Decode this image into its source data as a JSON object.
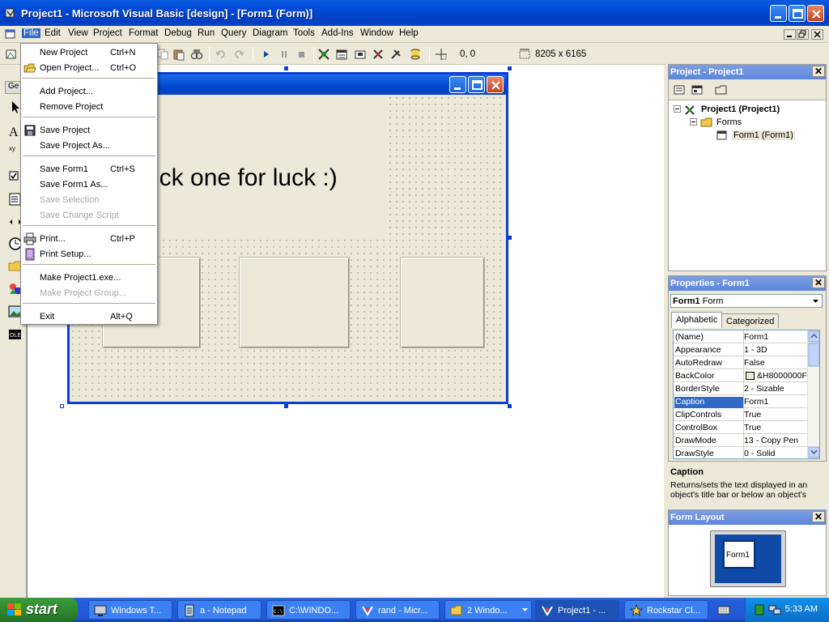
{
  "window": {
    "title": "Project1 - Microsoft Visual Basic [design] - [Form1 (Form)]"
  },
  "menubar": {
    "items": [
      "File",
      "Edit",
      "View",
      "Project",
      "Format",
      "Debug",
      "Run",
      "Query",
      "Diagram",
      "Tools",
      "Add-Ins",
      "Window",
      "Help"
    ],
    "active": "File"
  },
  "toolbar": {
    "position_readout": "0, 0",
    "size_readout": "8205 x 6165"
  },
  "toolbox": {
    "tab_label": "Ge"
  },
  "file_menu": {
    "items": [
      {
        "label": "New Project",
        "shortcut": "Ctrl+N",
        "enabled": true
      },
      {
        "label": "Open Project...",
        "shortcut": "Ctrl+O",
        "enabled": true,
        "icon": "open-folder-icon"
      },
      {
        "label": "Add Project...",
        "shortcut": "",
        "enabled": true
      },
      {
        "label": "Remove Project",
        "shortcut": "",
        "enabled": true
      },
      {
        "label": "Save Project",
        "shortcut": "",
        "enabled": true,
        "icon": "floppy-icon"
      },
      {
        "label": "Save Project As...",
        "shortcut": "",
        "enabled": true
      },
      {
        "label": "Save Form1",
        "shortcut": "Ctrl+S",
        "enabled": true
      },
      {
        "label": "Save Form1 As...",
        "shortcut": "",
        "enabled": true
      },
      {
        "label": "Save Selection",
        "shortcut": "",
        "enabled": false
      },
      {
        "label": "Save Change Script",
        "shortcut": "",
        "enabled": false
      },
      {
        "label": "Print...",
        "shortcut": "Ctrl+P",
        "enabled": true,
        "icon": "printer-icon"
      },
      {
        "label": "Print Setup...",
        "shortcut": "",
        "enabled": true,
        "icon": "print-setup-icon"
      },
      {
        "label": "Make Project1.exe...",
        "shortcut": "",
        "enabled": true
      },
      {
        "label": "Make Project Group...",
        "shortcut": "",
        "enabled": false
      },
      {
        "label": "Exit",
        "shortcut": "Alt+Q",
        "enabled": true
      }
    ]
  },
  "form_designer": {
    "label_text": "Pick one for luck :)"
  },
  "project_panel": {
    "title": "Project - Project1",
    "tree": {
      "root": "Project1 (Project1)",
      "folder": "Forms",
      "leaf": "Form1 (Form1)"
    }
  },
  "properties_panel": {
    "title": "Properties - Form1",
    "object_name": "Form1",
    "object_type": "Form",
    "tabs": [
      "Alphabetic",
      "Categorized"
    ],
    "active_tab": "Alphabetic",
    "rows": [
      {
        "name": "(Name)",
        "value": "Form1"
      },
      {
        "name": "Appearance",
        "value": "1 - 3D"
      },
      {
        "name": "AutoRedraw",
        "value": "False"
      },
      {
        "name": "BackColor",
        "value": "&H8000000F"
      },
      {
        "name": "BorderStyle",
        "value": "2 - Sizable"
      },
      {
        "name": "Caption",
        "value": "Form1"
      },
      {
        "name": "ClipControls",
        "value": "True"
      },
      {
        "name": "ControlBox",
        "value": "True"
      },
      {
        "name": "DrawMode",
        "value": "13 - Copy Pen"
      },
      {
        "name": "DrawStyle",
        "value": "0 - Solid"
      }
    ],
    "selected_row": "Caption",
    "description": {
      "title": "Caption",
      "text": "Returns/sets the text displayed in an object's title bar or below an object's"
    }
  },
  "layout_panel": {
    "title": "Form Layout",
    "form_label": "Form1"
  },
  "taskbar": {
    "start_label": "start",
    "tasks": [
      {
        "label": "Windows T...",
        "icon": "monitor-icon",
        "active": false
      },
      {
        "label": "a - Notepad",
        "icon": "notepad-icon",
        "active": false
      },
      {
        "label": "C:\\WINDO...",
        "icon": "console-icon",
        "active": false
      },
      {
        "label": "rand - Micr...",
        "icon": "vb-icon",
        "active": false
      },
      {
        "label": "2 Windo...",
        "icon": "folder-icon",
        "active": false
      },
      {
        "label": "Project1 - ...",
        "icon": "vb-icon",
        "active": true
      },
      {
        "label": "Rockstar Cl...",
        "icon": "rockstar-icon",
        "active": false
      }
    ],
    "clock": "5:33 AM"
  },
  "colors": {
    "titlebar": "#0048d6",
    "menu_highlight": "#316ac5",
    "taskbar": "#245ddb",
    "start_button": "#2f8a2f"
  }
}
